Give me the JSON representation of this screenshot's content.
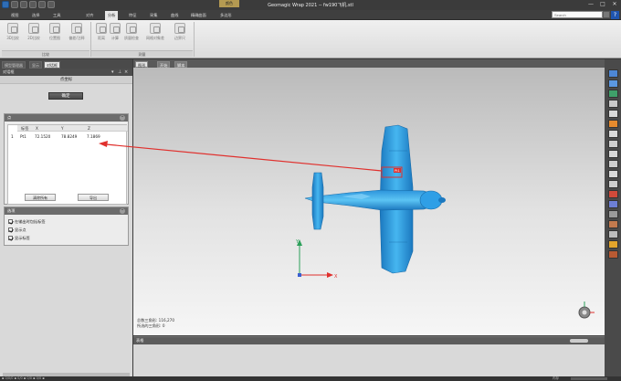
{
  "window": {
    "title": "Geomagic Wrap 2021 -- fw190飞机.stl",
    "badge": "颜色",
    "min": "—",
    "max": "□",
    "close": "✕"
  },
  "menu": {
    "items": [
      "视图",
      "选择",
      "工具",
      "对齐",
      "分析",
      "特征",
      "采集",
      "曲线",
      "精确曲面",
      "多边形"
    ],
    "active_index": 4,
    "search_placeholder": "Search",
    "help": "?"
  },
  "ribbon": {
    "buttons": [
      "3D比较",
      "2D比较",
      "位置图",
      "偏差/注释",
      "距离",
      "计算",
      "质量检查",
      "网格对象差",
      "边界尺"
    ],
    "groups": [
      "比较",
      "测量"
    ]
  },
  "left_panel": {
    "tabs": [
      "模型管理器",
      "显示",
      "对话框"
    ],
    "active_tab": 2,
    "dialog_title": "对话框",
    "dialog_name": "点坐标",
    "ok": "确定",
    "table_section": "点",
    "columns": [
      "标签",
      "X",
      "Y",
      "Z"
    ],
    "rows": [
      {
        "idx": "1",
        "label": "Pt1",
        "x": "72.1520",
        "y": "78.8249",
        "z": "7.1869"
      }
    ],
    "clear_all": "清除所有",
    "export": "导出",
    "options_section": "选项",
    "options": [
      "在输出时包括标签",
      "显示点",
      "显示标签"
    ]
  },
  "viewport": {
    "tabs": [
      "图形",
      "开始",
      "脚本"
    ],
    "active_tab": 0,
    "point_label": "Pt1",
    "stats": [
      "总数三角形: 116,270",
      "所选的三角形: 0"
    ],
    "axis_labels": [
      "Y",
      "X"
    ]
  },
  "bottom_panel": {
    "title": "表格"
  },
  "statusbar": {
    "left": "▪ 0/0/0 ▪ 0/0 ▪ 0/0 ▪ 0/0 ▪",
    "right": "内存"
  },
  "colors": {
    "model": "#33a3e8",
    "model_dark": "#1b78bf",
    "arrow": "#e0302d",
    "axis_x": "#e0302d",
    "axis_y": "#2ca05a",
    "axis_z": "#3a5fd0",
    "accent": "#2f6db5"
  },
  "icons": {
    "minimize": "minimize-icon",
    "maximize": "maximize-icon",
    "close": "close-icon",
    "help": "help-icon",
    "search": "search-icon",
    "collapse": "collapse-icon",
    "pin": "pin-icon",
    "view-cube": "view-cube-icon"
  }
}
